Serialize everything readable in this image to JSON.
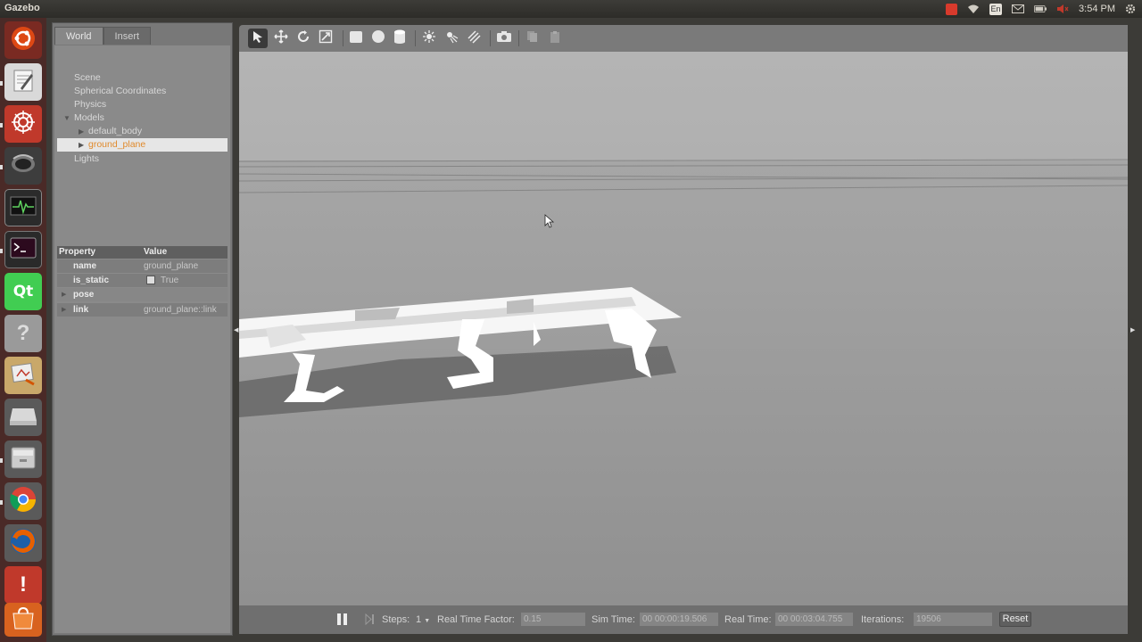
{
  "topbar": {
    "app_title": "Gazebo",
    "clock": "3:54 PM"
  },
  "launcher": {
    "items": [
      {
        "icon": "ubuntu-dash-icon"
      },
      {
        "icon": "text-editor-icon"
      },
      {
        "icon": "ros-bug-icon"
      },
      {
        "icon": "settings-eye-icon"
      },
      {
        "icon": "system-monitor-icon"
      },
      {
        "icon": "terminal-icon"
      },
      {
        "icon": "qt-creator-icon"
      },
      {
        "icon": "help-icon"
      },
      {
        "icon": "graphics-app-icon"
      },
      {
        "icon": "drive-icon"
      },
      {
        "icon": "file-manager-icon"
      },
      {
        "icon": "chrome-icon"
      },
      {
        "icon": "firefox-icon"
      },
      {
        "icon": "update-alert-icon"
      },
      {
        "icon": "ubuntu-software-icon"
      }
    ]
  },
  "left_panel": {
    "tabs": [
      "World",
      "Insert"
    ],
    "tree": {
      "scene": "Scene",
      "spherical": "Spherical Coordinates",
      "physics": "Physics",
      "models": "Models",
      "default_body": "default_body",
      "ground_plane": "ground_plane",
      "lights": "Lights"
    },
    "properties": {
      "header_property": "Property",
      "header_value": "Value",
      "rows": [
        {
          "name": "name",
          "value": "ground_plane"
        },
        {
          "name": "is_static",
          "value": "True"
        },
        {
          "name": "pose",
          "value": ""
        },
        {
          "name": "link",
          "value": "ground_plane::link"
        }
      ]
    }
  },
  "bottom_bar": {
    "steps_label": "Steps:",
    "steps_value": "1",
    "rtf_label": "Real Time Factor:",
    "rtf_value": "0.15",
    "sim_time_label": "Sim Time:",
    "sim_time_value": "00 00:00:19.506",
    "real_time_label": "Real Time:",
    "real_time_value": "00 00:03:04.755",
    "iterations_label": "Iterations:",
    "iterations_value": "19506",
    "reset_label": "Reset"
  }
}
